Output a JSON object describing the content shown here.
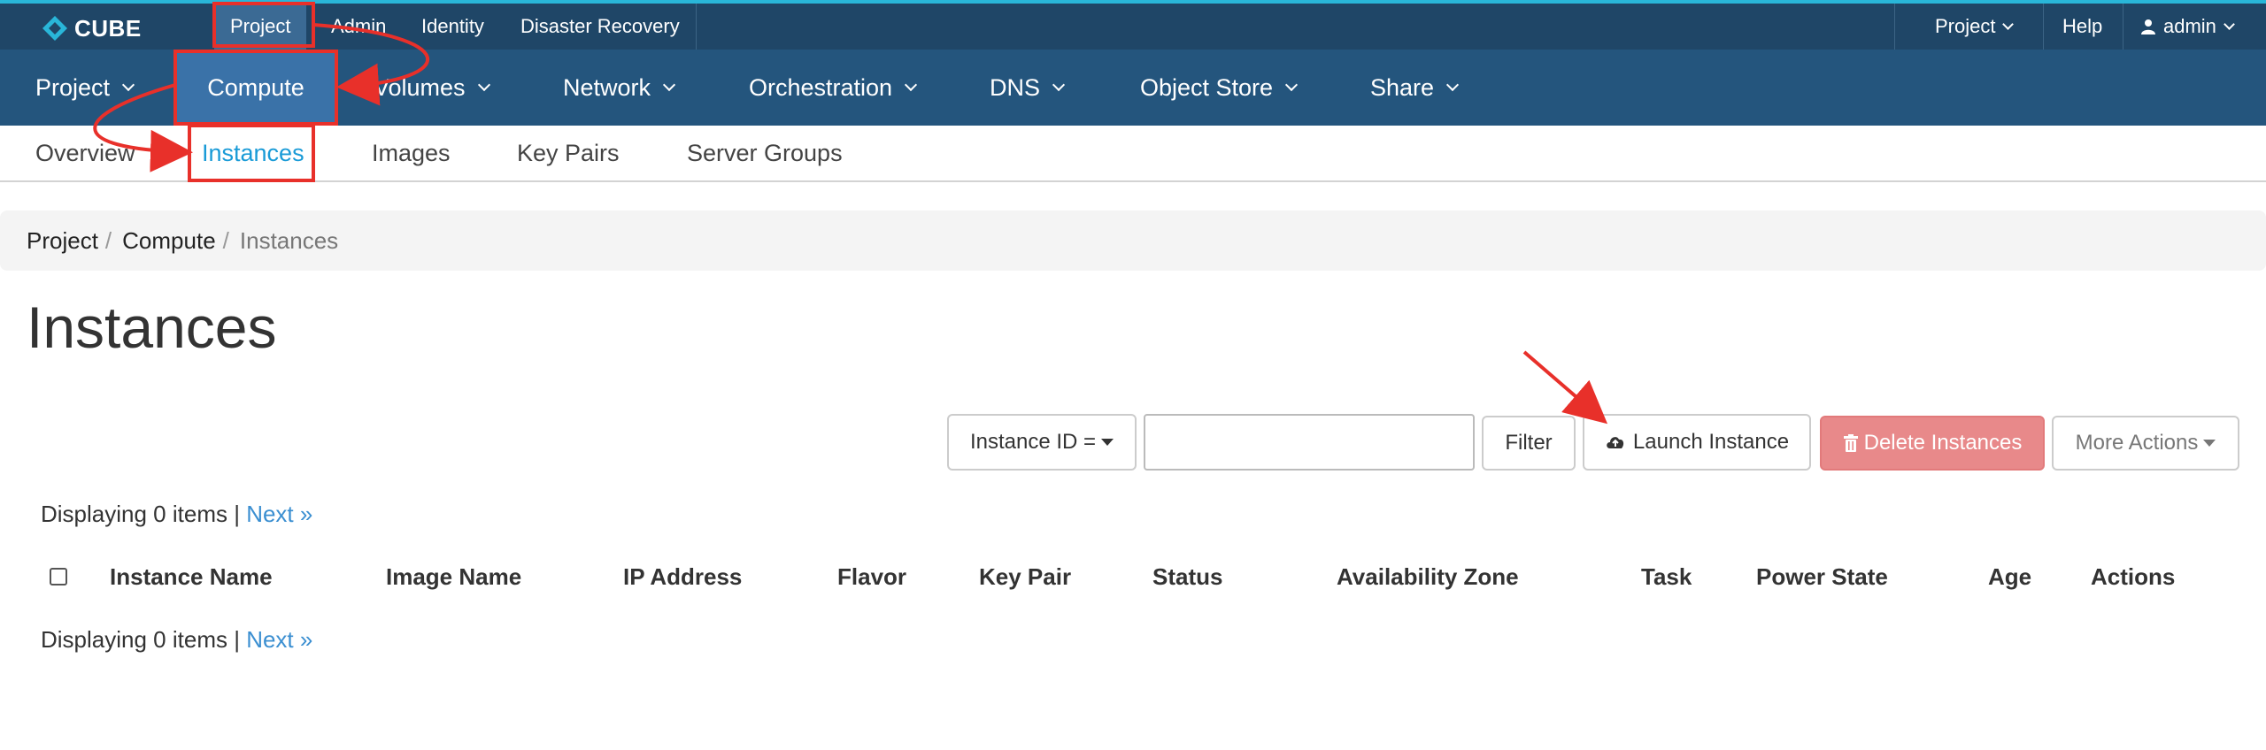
{
  "brand": {
    "name": "CUBE"
  },
  "topbar": {
    "left_links": [
      "Project",
      "Admin",
      "Identity",
      "Disaster Recovery"
    ],
    "project_menu": "Project",
    "help": "Help",
    "user": "admin"
  },
  "mainnav": {
    "items": [
      "Project",
      "Compute",
      "Volumes",
      "Network",
      "Orchestration",
      "DNS",
      "Object Store",
      "Share"
    ]
  },
  "subnav": {
    "items": [
      "Overview",
      "Instances",
      "Images",
      "Key Pairs",
      "Server Groups"
    ]
  },
  "breadcrumb": {
    "items": [
      "Project",
      "Compute"
    ],
    "current": "Instances",
    "separator": "/"
  },
  "page": {
    "title": "Instances"
  },
  "toolbar": {
    "filter_field": "Instance ID =",
    "search_value": "",
    "filter_label": "Filter",
    "launch_label": "Launch Instance",
    "delete_label": "Delete Instances",
    "more_label": "More Actions"
  },
  "table": {
    "displaying_text": "Displaying 0 items |",
    "next_label": "Next »",
    "columns": [
      "Instance Name",
      "Image Name",
      "IP Address",
      "Flavor",
      "Key Pair",
      "Status",
      "Availability Zone",
      "Task",
      "Power State",
      "Age",
      "Actions"
    ]
  },
  "colors": {
    "topbar": "#1f4667",
    "mainnav": "#24557d",
    "active_nav": "#3a72a8",
    "link": "#3b8fd1",
    "danger": "#e8898a",
    "annotation": "#e8302a"
  },
  "icons": {
    "logo": "cube-logo-icon",
    "user": "user-icon",
    "launch": "cloud-upload-icon",
    "delete": "trash-icon"
  }
}
